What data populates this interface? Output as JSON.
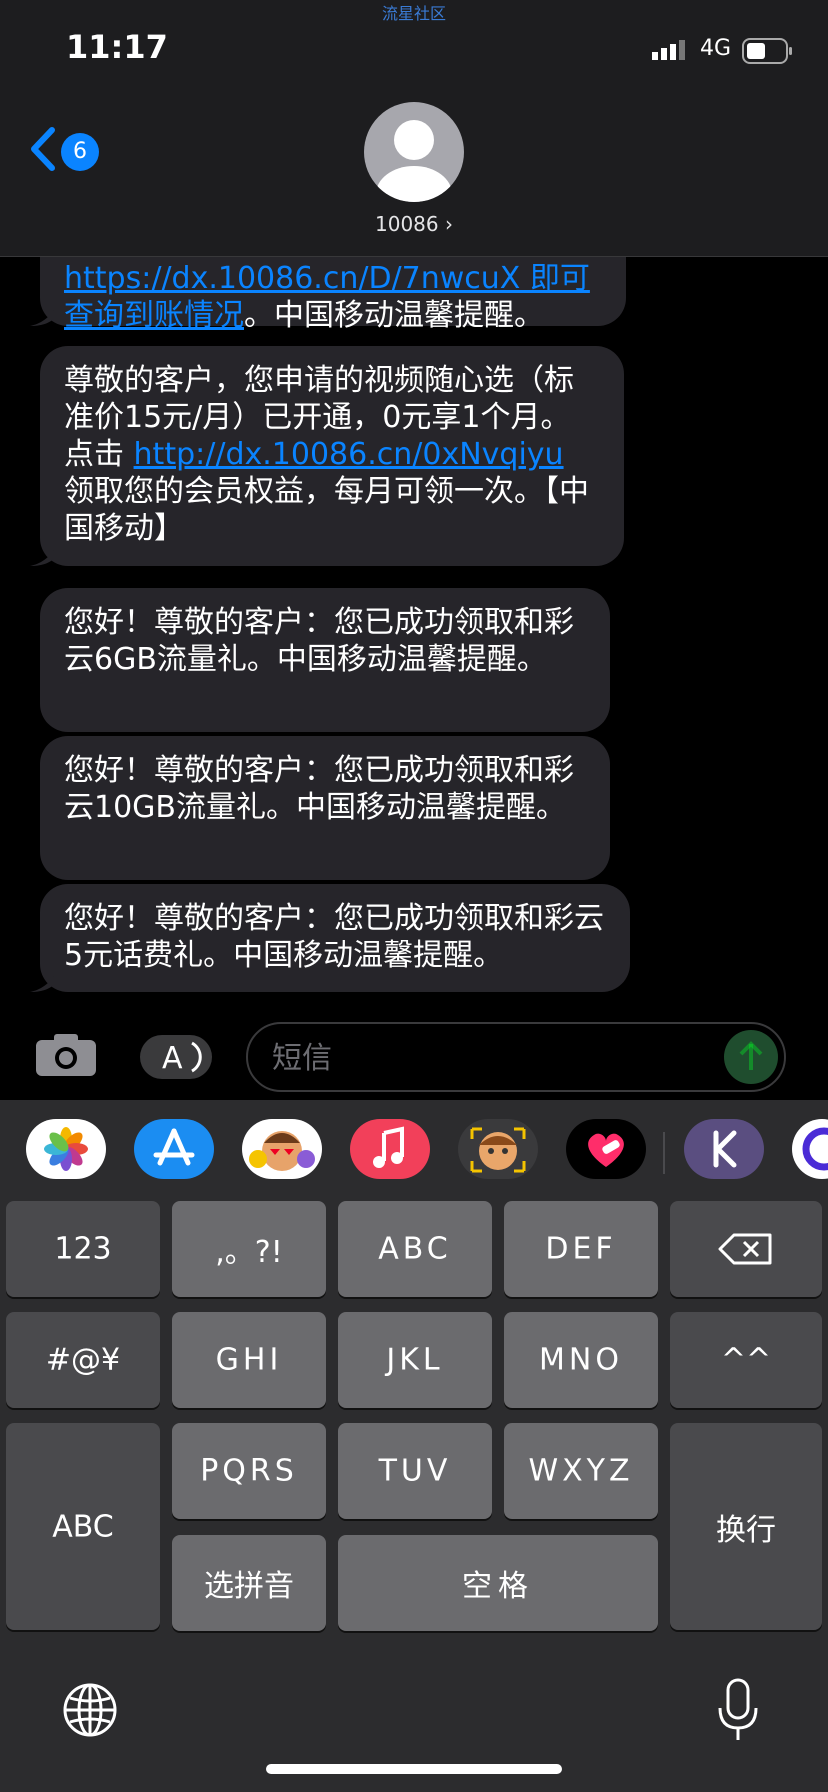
{
  "header": {
    "watermark": "流星社区",
    "time": "11:17",
    "network": "4G",
    "back_badge": "6",
    "contact_name": "10086 ›"
  },
  "messages": [
    {
      "parts": [
        {
          "link": "https://dx.10086.cn/D/7nwcuX 即可查询到账情况"
        },
        {
          "text": "。中国移动温馨提醒。"
        }
      ]
    },
    {
      "parts": [
        {
          "text": "尊敬的客户，您申请的视频随心选（标准价15元/月）已开通，0元享1个月。点击 "
        },
        {
          "link": "http://dx.10086.cn/0xNvqiyu"
        },
        {
          "text": " 领取您的会员权益，每月可领一次。【中国移动】"
        }
      ]
    },
    {
      "parts": [
        {
          "text": "您好！尊敬的客户：您已成功领取和彩云6GB流量礼。中国移动温馨提醒。"
        }
      ]
    },
    {
      "parts": [
        {
          "text": "您好！尊敬的客户：您已成功领取和彩云10GB流量礼。中国移动温馨提醒。"
        }
      ]
    },
    {
      "parts": [
        {
          "text": "您好！尊敬的客户：您已成功领取和彩云5元话费礼。中国移动温馨提醒。"
        }
      ]
    }
  ],
  "input": {
    "placeholder": "短信"
  },
  "app_strip": [
    "photos-app",
    "app-store-app",
    "stickers-app",
    "music-app",
    "memoji-app",
    "heart-app",
    "k-app",
    "partial-app"
  ],
  "keyboard": {
    "row1": [
      "123",
      ",。?!",
      "ABC",
      "DEF"
    ],
    "row2": [
      "#@¥",
      "GHI",
      "JKL",
      "MNO",
      "^^"
    ],
    "row3": [
      "PQRS",
      "TUV",
      "WXYZ"
    ],
    "abc": "ABC",
    "enter": "换行",
    "pinyin": "选拼音",
    "space": "空格"
  },
  "colors": {
    "accent": "#0a84ff",
    "bubble": "#26252a"
  }
}
